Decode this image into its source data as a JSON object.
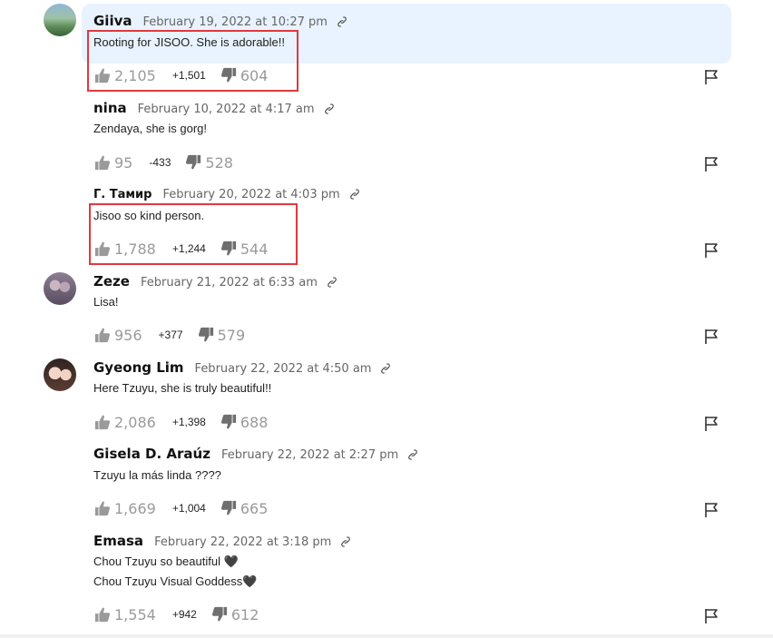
{
  "comments": [
    {
      "author": "Giiva",
      "date": "February 19, 2022 at 10:27 pm",
      "text": "Rooting for JISOO. She is adorable!!",
      "up": "2,105",
      "net": "+1,501",
      "down": "604"
    },
    {
      "author": "nina",
      "date": "February 10, 2022 at 4:17 am",
      "text": "Zendaya, she is gorg!",
      "up": "95",
      "net": "-433",
      "down": "528"
    },
    {
      "author": "Г. Тамир",
      "date": "February 20, 2022 at 4:03 pm",
      "text": "Jisoo so kind person.",
      "up": "1,788",
      "net": "+1,244",
      "down": "544"
    },
    {
      "author": "Zeze",
      "date": "February 21, 2022 at 6:33 am",
      "text": "Lisa!",
      "up": "956",
      "net": "+377",
      "down": "579"
    },
    {
      "author": "Gyeong Lim",
      "date": "February 22, 2022 at 4:50 am",
      "text": "Here Tzuyu, she is truly beautiful!!",
      "up": "2,086",
      "net": "+1,398",
      "down": "688"
    },
    {
      "author": "Gisela D. Araúz",
      "date": "February 22, 2022 at 2:27 pm",
      "text": "Tzuyu la más linda ????",
      "up": "1,669",
      "net": "+1,004",
      "down": "665"
    },
    {
      "author": "Emasa",
      "date": "February 22, 2022 at 3:18 pm",
      "text_lines": [
        "Chou Tzuyu so beautiful 🖤",
        "Chou Tzuyu Visual Goddess🖤"
      ],
      "up": "1,554",
      "net": "+942",
      "down": "612"
    }
  ],
  "icons": {
    "like": "thumbs-up-icon",
    "dislike": "thumbs-down-icon",
    "permalink": "link-icon",
    "report": "flag-icon"
  },
  "colors": {
    "highlight_bg": "#e8f3ff",
    "annotation_box": "#e0393e",
    "vote_count": "#9a9a9a"
  }
}
